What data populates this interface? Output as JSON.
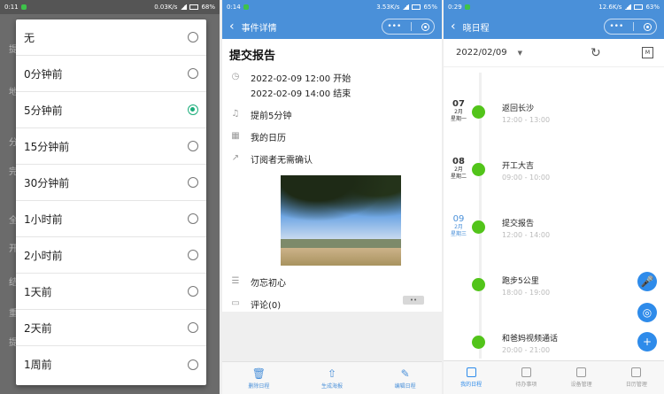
{
  "panel1": {
    "status": {
      "time": "0:11",
      "speed": "0.03K/s",
      "battery": "68%"
    },
    "background_labels": [
      "提",
      "地",
      "分",
      "完",
      "全",
      "开",
      "结",
      "重",
      "提"
    ],
    "options": [
      {
        "label": "无",
        "selected": false
      },
      {
        "label": "0分钟前",
        "selected": false
      },
      {
        "label": "5分钟前",
        "selected": true
      },
      {
        "label": "15分钟前",
        "selected": false
      },
      {
        "label": "30分钟前",
        "selected": false
      },
      {
        "label": "1小时前",
        "selected": false
      },
      {
        "label": "2小时前",
        "selected": false
      },
      {
        "label": "1天前",
        "selected": false
      },
      {
        "label": "2天前",
        "selected": false
      },
      {
        "label": "1周前",
        "selected": false
      }
    ]
  },
  "panel2": {
    "status": {
      "time": "0:14",
      "speed": "3.53K/s",
      "battery": "65%"
    },
    "nav_title": "事件详情",
    "capsule_more": "•••",
    "event_title": "提交报告",
    "start": "2022-02-09 12:00 开始",
    "end": "2022-02-09 14:00 结束",
    "reminder": "提前5分钟",
    "calendar": "我的日历",
    "subscribers": "订阅者无需确认",
    "note": "勿忘初心",
    "comments": "评论(0)",
    "comment_button": "••",
    "bottom_tabs": [
      {
        "icon": "trash-icon",
        "glyph": "🗑",
        "label": "删除日程"
      },
      {
        "icon": "share-icon",
        "glyph": "⇧",
        "label": "生成海报"
      },
      {
        "icon": "edit-icon",
        "glyph": "✎",
        "label": "编辑日程"
      }
    ]
  },
  "panel3": {
    "status": {
      "time": "0:29",
      "speed": "12.6K/s",
      "battery": "63%"
    },
    "nav_title": "晓日程",
    "capsule_more": "•••",
    "date": "2022/02/09",
    "calendar_icon_label": "M",
    "events": [
      {
        "day": "07",
        "month": "2月",
        "weekday": "星期一",
        "title": "返回长沙",
        "time": "12:00 - 13:00",
        "today": false
      },
      {
        "day": "08",
        "month": "2月",
        "weekday": "星期二",
        "title": "开工大吉",
        "time": "09:00 - 10:00",
        "today": false
      },
      {
        "day": "09",
        "month": "2月",
        "weekday": "星期三",
        "title": "提交报告",
        "time": "12:00 - 14:00",
        "today": true
      },
      {
        "day": "",
        "month": "",
        "weekday": "",
        "title": "跑步5公里",
        "time": "18:00 - 19:00",
        "today": false
      },
      {
        "day": "",
        "month": "",
        "weekday": "",
        "title": "和爸妈视频通话",
        "time": "20:00 - 21:00",
        "today": false
      }
    ],
    "fabs": [
      {
        "icon": "microphone-icon",
        "glyph": "🎤"
      },
      {
        "icon": "wifi-icon",
        "glyph": "◎"
      },
      {
        "icon": "plus-icon",
        "glyph": "+"
      }
    ],
    "bottom_tabs": [
      {
        "label": "我的日程",
        "active": true
      },
      {
        "label": "待办事项",
        "active": false
      },
      {
        "label": "设备管理",
        "active": false
      },
      {
        "label": "日历管理",
        "active": false
      }
    ]
  },
  "colors": {
    "primary_blue": "#4a90d9",
    "green_node": "#52c41a",
    "radio_green": "#1aad7a"
  }
}
